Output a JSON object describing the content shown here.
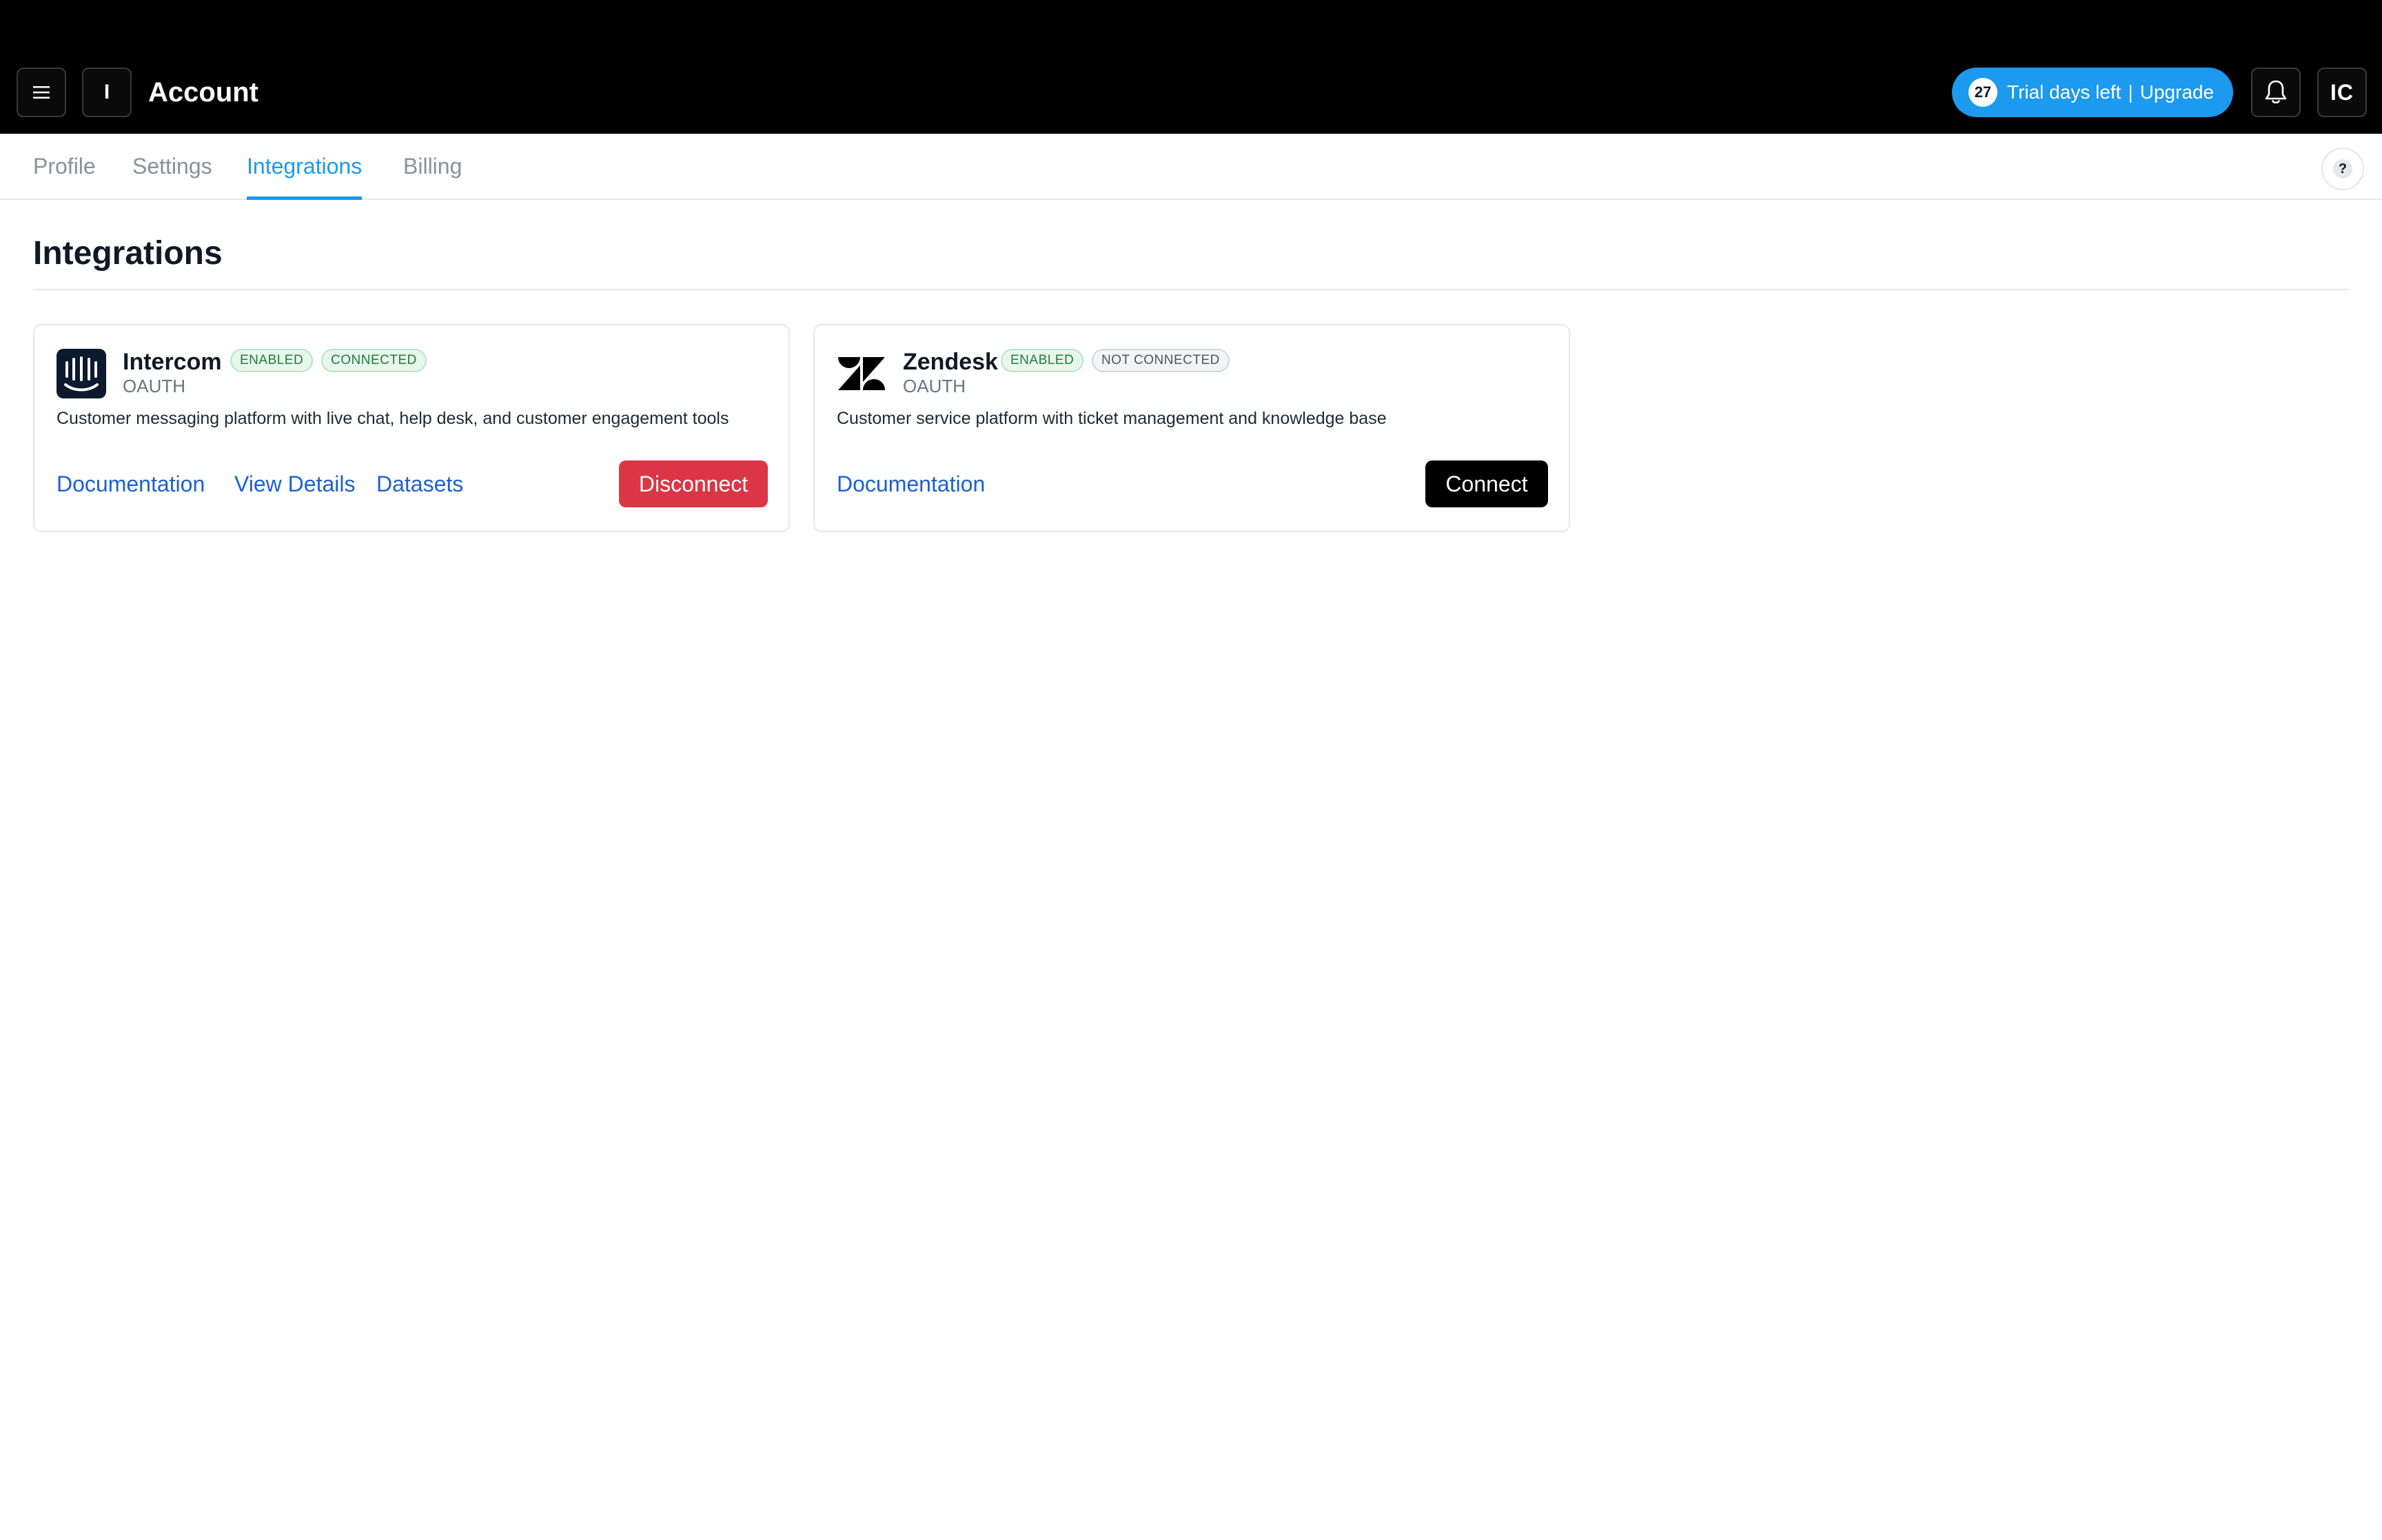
{
  "header": {
    "logo_letter": "I",
    "title": "Account",
    "trial": {
      "days": "27",
      "label": "Trial days left",
      "separator": "|",
      "upgrade": "Upgrade"
    },
    "avatar_initials": "IC",
    "accent_color": "#1b9af0"
  },
  "tabs": [
    {
      "label": "Profile",
      "active": false
    },
    {
      "label": "Settings",
      "active": false
    },
    {
      "label": "Integrations",
      "active": true
    },
    {
      "label": "Billing",
      "active": false
    }
  ],
  "help_label": "?",
  "page": {
    "title": "Integrations"
  },
  "integrations": [
    {
      "name": "Intercom",
      "auth_type": "OAUTH",
      "badges": [
        "ENABLED",
        "CONNECTED"
      ],
      "description": "Customer messaging platform with live chat, help desk, and customer engagement tools",
      "links": [
        "Documentation",
        "View Details",
        "Datasets"
      ],
      "action": "Disconnect",
      "action_color": "#dc3545",
      "icon": "intercom-logo-icon"
    },
    {
      "name": "Zendesk",
      "auth_type": "OAUTH",
      "badges": [
        "ENABLED",
        "NOT CONNECTED"
      ],
      "description": "Customer service platform with ticket management and knowledge base",
      "links": [
        "Documentation"
      ],
      "action": "Connect",
      "action_color": "#000000",
      "icon": "zendesk-logo-icon"
    }
  ]
}
